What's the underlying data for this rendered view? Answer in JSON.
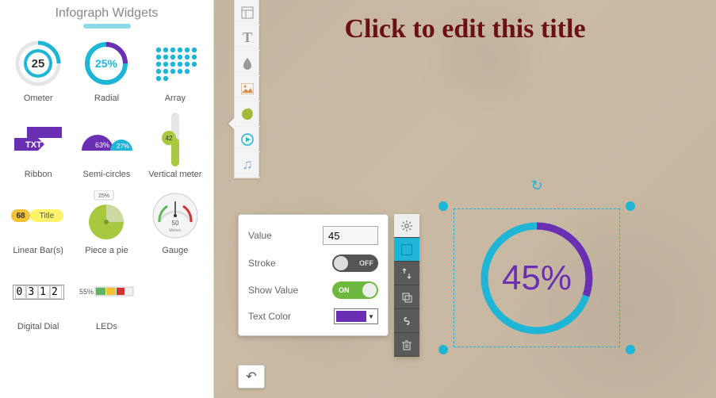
{
  "panel": {
    "title": "Infograph Widgets"
  },
  "widgets": {
    "ometer": {
      "label": "Ometer",
      "value": "25"
    },
    "radial": {
      "label": "Radial",
      "value": "25%"
    },
    "array": {
      "label": "Array"
    },
    "ribbon": {
      "label": "Ribbon",
      "text": "TXT"
    },
    "semi": {
      "label": "Semi-circles",
      "left": "63%",
      "right": "27%"
    },
    "vmeter": {
      "label": "Vertical meter",
      "value": "42"
    },
    "linear": {
      "label": "Linear Bar(s)",
      "num": "68",
      "text": "Title"
    },
    "pie": {
      "label": "Piece a pie",
      "value": "25%"
    },
    "gauge": {
      "label": "Gauge",
      "value": "50",
      "unit": "Meters"
    },
    "digital": {
      "label": "Digital Dial",
      "value": "0312"
    },
    "leds": {
      "label": "LEDs",
      "value": "55%"
    }
  },
  "canvas": {
    "title": "Click to edit this title"
  },
  "props": {
    "value_label": "Value",
    "value": "45",
    "stroke_label": "Stroke",
    "stroke_state": "OFF",
    "show_label": "Show Value",
    "show_state": "ON",
    "color_label": "Text Color",
    "color": "#6b2fb3"
  },
  "selected": {
    "display": "45%"
  },
  "vtoolbar": [
    "layout",
    "text",
    "droplet",
    "image",
    "chart",
    "video",
    "music"
  ],
  "mtoolbar": [
    "gear",
    "color",
    "arrange",
    "duplicate",
    "link",
    "delete"
  ]
}
